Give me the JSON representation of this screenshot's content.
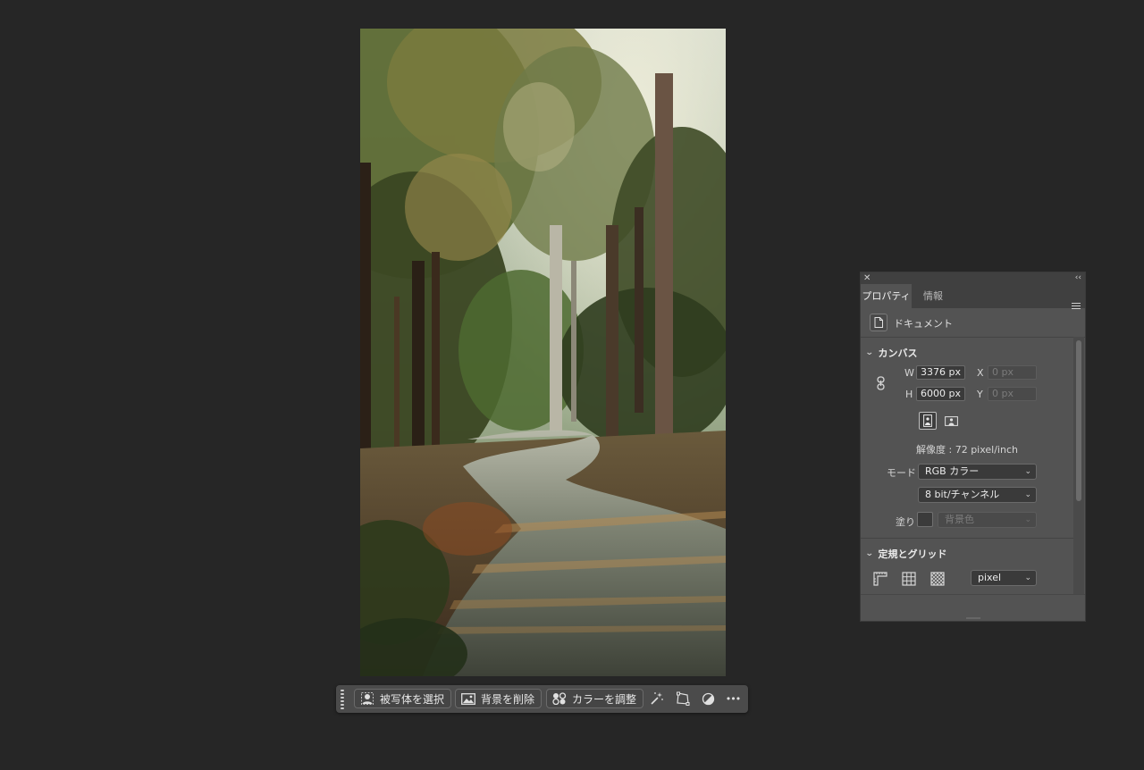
{
  "taskbar": {
    "select_subject_label": "被写体を選択",
    "remove_background_label": "背景を削除",
    "adjust_color_label": "カラーを調整",
    "more_label": "•••"
  },
  "panel": {
    "tabs": [
      {
        "label": "プロパティ",
        "active": true
      },
      {
        "label": "情報",
        "active": false
      }
    ],
    "document_label": "ドキュメント",
    "canvas": {
      "title": "カンバス",
      "w_label": "W",
      "w_value": "3376 px",
      "h_label": "H",
      "h_value": "6000 px",
      "x_label": "X",
      "x_value": "0 px",
      "y_label": "Y",
      "y_value": "0 px",
      "resolution": "解像度 : 72 pixel/inch",
      "mode_label": "モード",
      "mode_value": "RGB カラー",
      "bit_depth_value": "8 bit/チャンネル",
      "fill_label": "塗り",
      "fill_value": "背景色"
    },
    "rulers": {
      "title": "定規とグリッド",
      "unit_value": "pixel"
    }
  },
  "colors": {
    "background": "#262626",
    "panel": "#535353",
    "panel_header": "#404040",
    "taskbar": "#4b4b4b"
  }
}
